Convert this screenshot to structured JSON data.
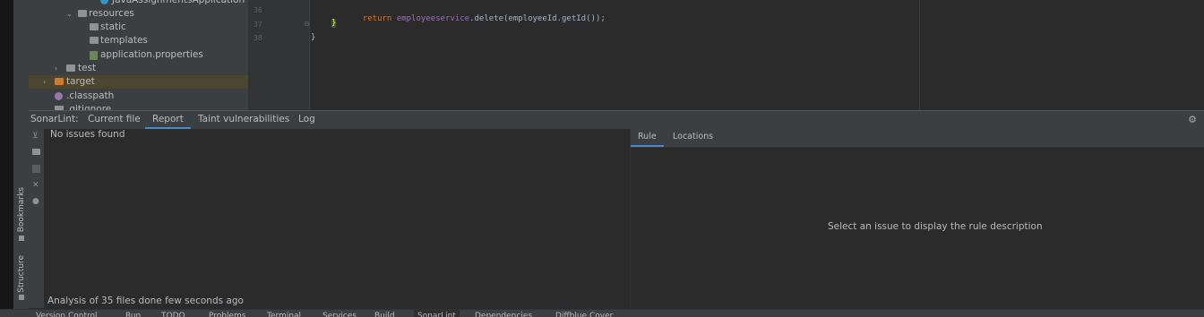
{
  "side_tabs": {
    "bookmarks": "Bookmarks",
    "structure": "Structure"
  },
  "project_tree": {
    "items": [
      {
        "label": "JavaAssignmentsApplication"
      },
      {
        "label": "resources"
      },
      {
        "label": "static"
      },
      {
        "label": "templates"
      },
      {
        "label": "application.properties"
      },
      {
        "label": "test"
      },
      {
        "label": "target"
      },
      {
        "label": ".classpath"
      },
      {
        "label": ".gitignore"
      }
    ]
  },
  "editor": {
    "line_numbers": [
      "36",
      "37",
      "38"
    ],
    "lines": [
      {
        "keyword": "return ",
        "field": "employeeservice",
        "rest": ".delete(employeeId.getId());"
      },
      {
        "brace": "}"
      },
      {
        "brace": "}"
      }
    ]
  },
  "sonarlint": {
    "title": "SonarLint:",
    "tabs": [
      "Current file",
      "Report",
      "Taint vulnerabilities",
      "Log"
    ],
    "active_tab": "Report",
    "issues_message": "No issues found",
    "analysis_status": "Analysis of 35 files done few seconds ago",
    "rule_tabs": [
      "Rule",
      "Locations"
    ],
    "active_rule_tab": "Rule",
    "rule_placeholder": "Select an issue to display the rule description"
  },
  "bottom_bar": {
    "items": [
      "Version Control",
      "Run",
      "TODO",
      "Problems",
      "Terminal",
      "Services",
      "Build",
      "SonarLint",
      "Dependencies",
      "Diffblue Cover"
    ],
    "active": "SonarLint"
  },
  "colors": {
    "accent": "#4a88c7",
    "keyword": "#cc7832",
    "field": "#9876aa",
    "folder": "#8f9296",
    "target_folder": "#d07a2c"
  }
}
